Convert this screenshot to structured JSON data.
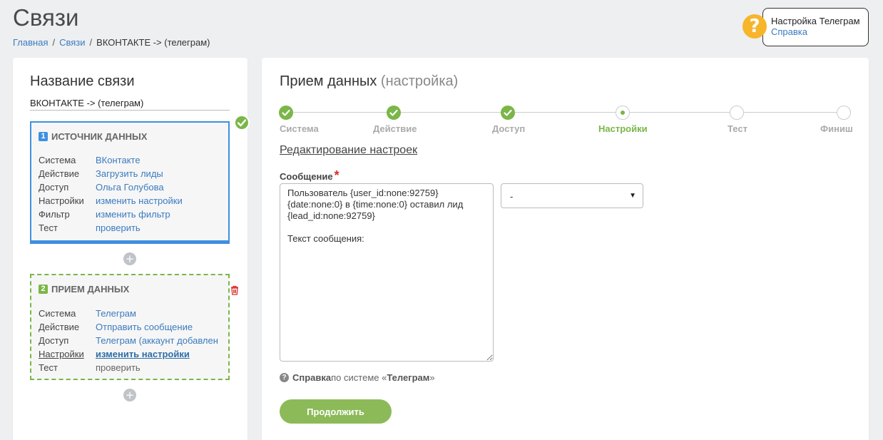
{
  "page": {
    "title": "Связи"
  },
  "breadcrumb": {
    "home": "Главная",
    "links": "Связи",
    "current": "ВКОНТАКТЕ -> (телеграм)"
  },
  "help_box": {
    "title": "Настройка Телеграм",
    "link": "Справка",
    "icon": "?"
  },
  "left": {
    "heading": "Название связи",
    "connection_name": "ВКОНТАКТЕ -> (телеграм)",
    "source": {
      "number": "1",
      "title": "ИСТОЧНИК ДАННЫХ",
      "rows": [
        {
          "k": "Система",
          "v": "ВКонтакте"
        },
        {
          "k": "Действие",
          "v": "Загрузить лиды"
        },
        {
          "k": "Доступ",
          "v": "Ольга Голубова"
        },
        {
          "k": "Настройки",
          "v": "изменить настройки"
        },
        {
          "k": "Фильтр",
          "v": "изменить фильтр"
        },
        {
          "k": "Тест",
          "v": "проверить"
        }
      ]
    },
    "receiver": {
      "number": "2",
      "title": "ПРИЕМ ДАННЫХ",
      "rows": [
        {
          "k": "Система",
          "v": "Телеграм"
        },
        {
          "k": "Действие",
          "v": "Отправить сообщение"
        },
        {
          "k": "Доступ",
          "v": "Телеграм (аккаунт добавлен"
        },
        {
          "k": "Настройки",
          "v": "изменить настройки"
        },
        {
          "k": "Тест",
          "v": "проверить"
        }
      ]
    },
    "plus": "+"
  },
  "main": {
    "heading": "Прием данных",
    "heading_sub": "(настройка)",
    "steps": [
      "Система",
      "Действие",
      "Доступ",
      "Настройки",
      "Тест",
      "Финиш"
    ],
    "edit_title": "Редактирование настроек",
    "message_label": "Сообщение",
    "required_mark": "*",
    "message_value": "Пользователь {user_id:none:92759}\n{date:none:0} в {time:none:0} оставил лид\n{lead_id:none:92759}\n\nТекст сообщения:",
    "select_value": "-",
    "help_prefix": "Справка",
    "help_middle": " по системе «",
    "help_system": "Телеграм",
    "help_suffix": "»",
    "continue_label": "Продолжить"
  },
  "colors": {
    "accent_green": "#7ab648",
    "accent_blue": "#3f8fe0",
    "link": "#3b7bbf",
    "help_yellow": "#f7b52c"
  }
}
